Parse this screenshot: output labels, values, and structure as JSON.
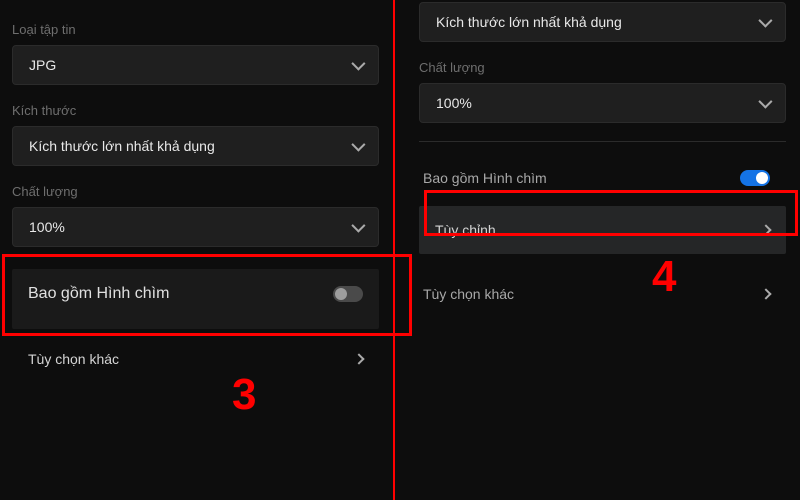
{
  "left": {
    "file_type_label": "Loại tập tin",
    "file_type_value": "JPG",
    "dimensions_label": "Kích thước",
    "dimensions_value": "Kích thước lớn nhất khả dụng",
    "quality_label": "Chất lượng",
    "quality_value": "100%",
    "watermark_label": "Bao gồm Hình chìm",
    "watermark_on": false,
    "more_options": "Tùy chọn khác"
  },
  "right": {
    "dimensions_value": "Kích thước lớn nhất khả dụng",
    "quality_label": "Chất lượng",
    "quality_value": "100%",
    "watermark_label": "Bao gồm Hình chìm",
    "watermark_on": true,
    "customize": "Tùy chỉnh",
    "more_options": "Tùy chọn khác"
  },
  "annotations": {
    "step3": "3",
    "step4": "4"
  }
}
